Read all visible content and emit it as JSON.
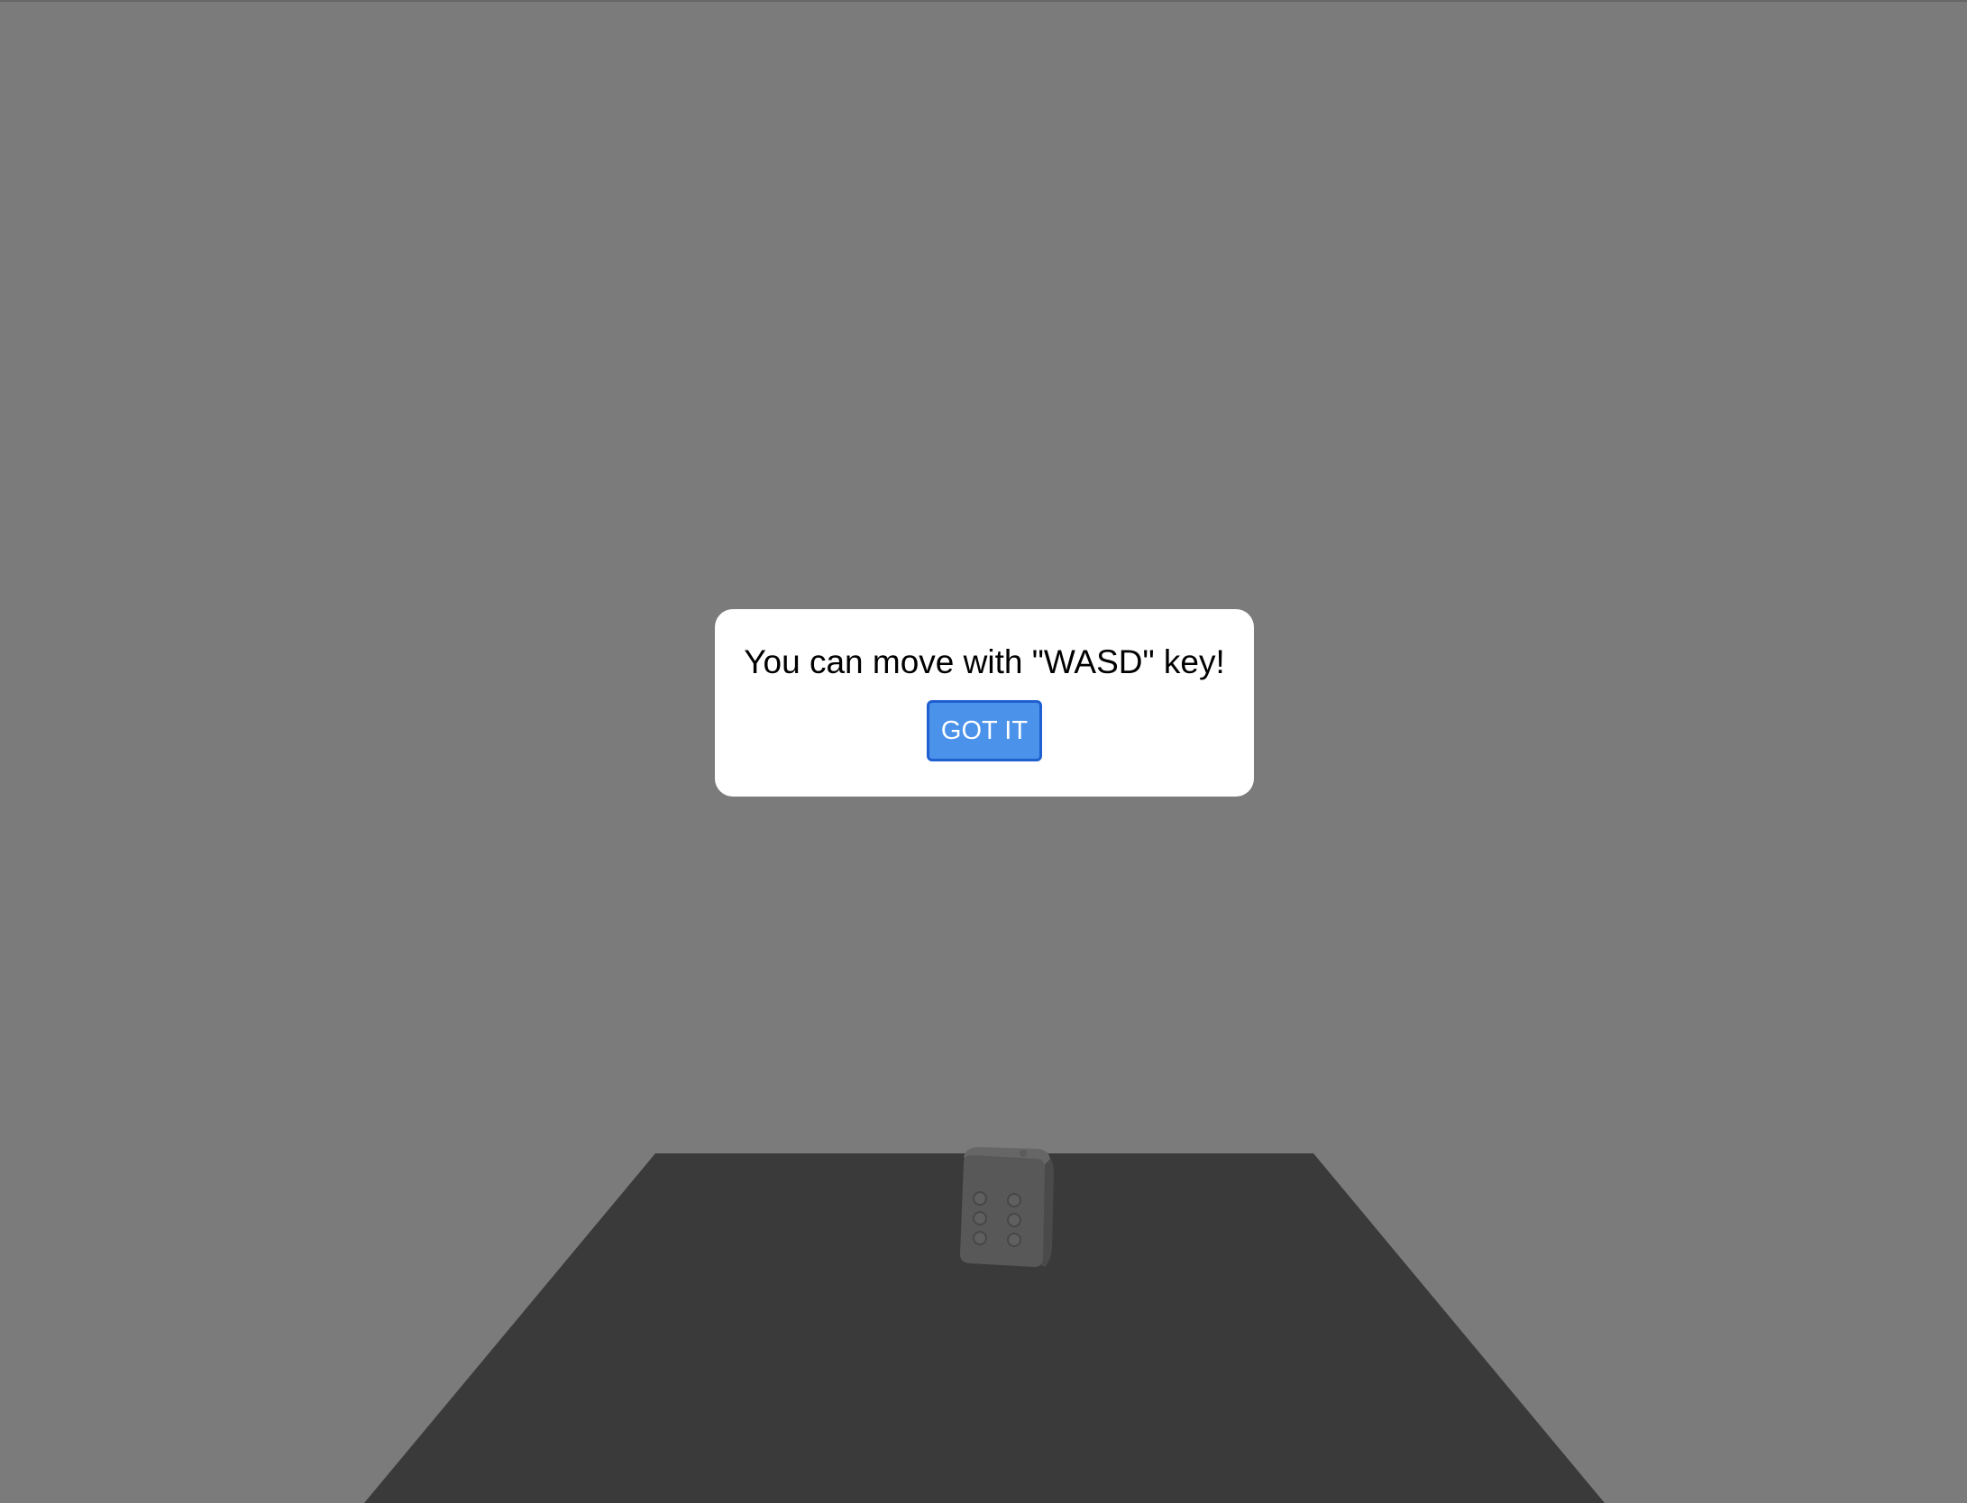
{
  "scene": {
    "background_color": "#7b7b7b",
    "floor_color": "#3a3a3a",
    "die": {
      "color": "#5a5a5a",
      "front_face_value": 6,
      "top_face_value": 2
    }
  },
  "dialog": {
    "message": "You can move with \"WASD\" key!",
    "button_label": "GOT IT",
    "button_color": "#4a92ea"
  }
}
